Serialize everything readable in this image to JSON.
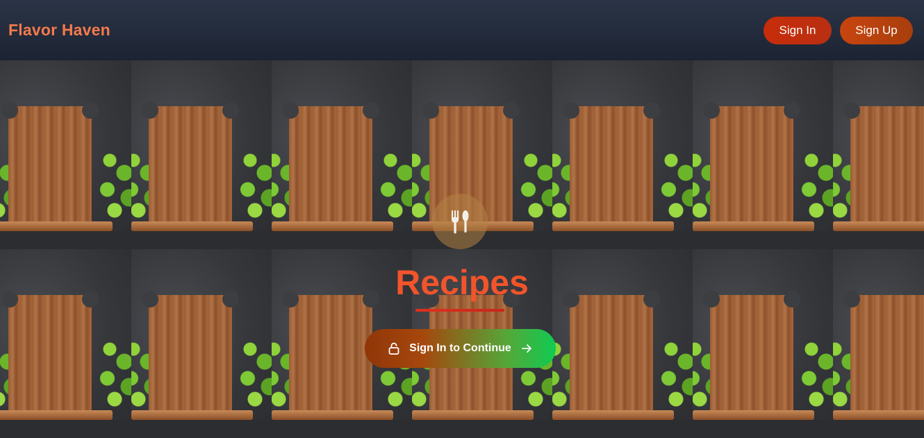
{
  "header": {
    "brand": "Flavor Haven",
    "sign_in_label": "Sign In",
    "sign_up_label": "Sign Up"
  },
  "hero": {
    "title": "Recipes",
    "cta_label": "Sign In to Continue",
    "icon": "utensils-icon"
  },
  "colors": {
    "brand": "#f37a4c",
    "title": "#f2542b",
    "header_bg": "#1c2433"
  }
}
